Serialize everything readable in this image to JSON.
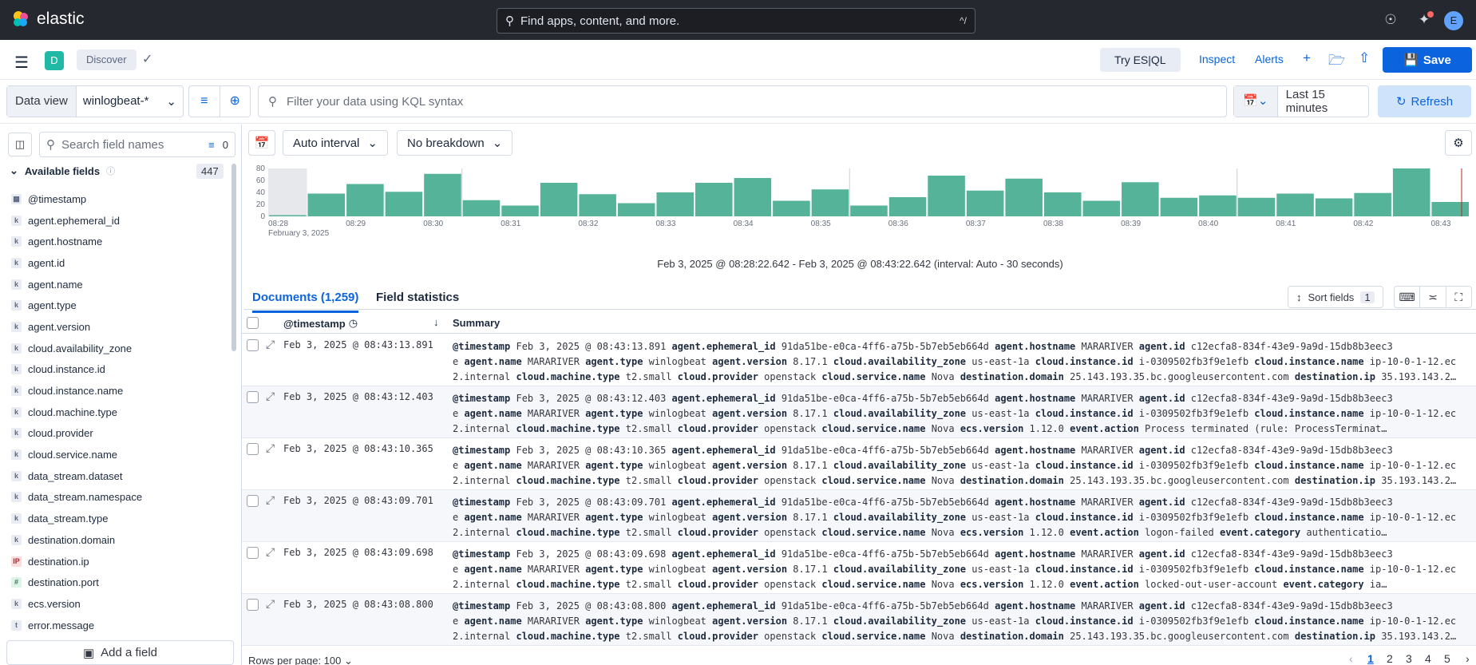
{
  "topbar": {
    "brand": "elastic",
    "search_placeholder": "Find apps, content, and more.",
    "shortcut": "^/",
    "avatar_letter": "E"
  },
  "appbar": {
    "space_letter": "D",
    "breadcrumb": "Discover",
    "try_esql": "Try ES|QL",
    "inspect": "Inspect",
    "alerts": "Alerts",
    "save": "Save"
  },
  "querybar": {
    "data_view_label": "Data view",
    "data_view_value": "winlogbeat-*",
    "kql_placeholder": "Filter your data using KQL syntax",
    "time_range": "Last 15 minutes",
    "refresh": "Refresh"
  },
  "sidebar": {
    "search_placeholder": "Search field names",
    "filter_count": "0",
    "available_label": "Available fields",
    "available_count": "447",
    "add_field": "Add a field",
    "fields": [
      {
        "type": "date",
        "name": "@timestamp"
      },
      {
        "type": "k",
        "name": "agent.ephemeral_id"
      },
      {
        "type": "k",
        "name": "agent.hostname"
      },
      {
        "type": "k",
        "name": "agent.id"
      },
      {
        "type": "k",
        "name": "agent.name"
      },
      {
        "type": "k",
        "name": "agent.type"
      },
      {
        "type": "k",
        "name": "agent.version"
      },
      {
        "type": "k",
        "name": "cloud.availability_zone"
      },
      {
        "type": "k",
        "name": "cloud.instance.id"
      },
      {
        "type": "k",
        "name": "cloud.instance.name"
      },
      {
        "type": "k",
        "name": "cloud.machine.type"
      },
      {
        "type": "k",
        "name": "cloud.provider"
      },
      {
        "type": "k",
        "name": "cloud.service.name"
      },
      {
        "type": "k",
        "name": "data_stream.dataset"
      },
      {
        "type": "k",
        "name": "data_stream.namespace"
      },
      {
        "type": "k",
        "name": "data_stream.type"
      },
      {
        "type": "k",
        "name": "destination.domain"
      },
      {
        "type": "ip",
        "name": "destination.ip"
      },
      {
        "type": "num",
        "name": "destination.port"
      },
      {
        "type": "k",
        "name": "ecs.version"
      },
      {
        "type": "t",
        "name": "error.message"
      }
    ]
  },
  "histogram": {
    "interval": "Auto interval",
    "breakdown": "No breakdown",
    "caption": "Feb 3, 2025 @ 08:28:22.642 - Feb 3, 2025 @ 08:43:22.642 (interval: Auto - 30 seconds)",
    "date_sub": "February 3, 2025",
    "bar_color": "#54b399"
  },
  "chart_data": {
    "type": "bar",
    "ylim": [
      0,
      80
    ],
    "yticks": [
      "80",
      "60",
      "40",
      "20",
      "0"
    ],
    "xticks": [
      "08:28",
      "08:29",
      "08:30",
      "08:31",
      "08:32",
      "08:33",
      "08:34",
      "08:35",
      "08:36",
      "08:37",
      "08:38",
      "08:39",
      "08:40",
      "08:41",
      "08:42",
      "08:43"
    ],
    "values": [
      2,
      38,
      54,
      41,
      71,
      27,
      18,
      56,
      37,
      22,
      40,
      56,
      64,
      26,
      45,
      18,
      32,
      68,
      43,
      63,
      40,
      26,
      57,
      31,
      35,
      31,
      38,
      30,
      39,
      80,
      24
    ]
  },
  "documents": {
    "tab_docs": "Documents (1,259)",
    "tab_stats": "Field statistics",
    "sort_fields": "Sort fields",
    "sort_count": "1",
    "col_timestamp": "@timestamp",
    "col_summary": "Summary",
    "rows": [
      {
        "ts": "Feb 3, 2025 @ 08:43:13.891",
        "l1": "<b>@timestamp</b> Feb 3, 2025 @ 08:43:13.891 <b>agent.ephemeral_id</b> 91da51be-e0ca-4ff6-a75b-5b7eb5eb664d <b>agent.hostname</b> MARARIVER <b>agent.id</b> c12ecfa8-834f-43e9-9a9d-15db8b3eec3",
        "l2": "e <b>agent.name</b> MARARIVER <b>agent.type</b> winlogbeat <b>agent.version</b> 8.17.1 <b>cloud.availability_zone</b> us-east-1a <b>cloud.instance.id</b> i-0309502fb3f9e1efb <b>cloud.instance.name</b> ip-10-0-1-12.ec",
        "l3": "2.internal <b>cloud.machine.type</b> t2.small <b>cloud.provider</b> openstack <b>cloud.service.name</b> Nova <b>destination.domain</b> 25.143.193.35.bc.googleusercontent.com <b>destination.ip</b> 35.193.143.2…"
      },
      {
        "ts": "Feb 3, 2025 @ 08:43:12.403",
        "l1": "<b>@timestamp</b> Feb 3, 2025 @ 08:43:12.403 <b>agent.ephemeral_id</b> 91da51be-e0ca-4ff6-a75b-5b7eb5eb664d <b>agent.hostname</b> MARARIVER <b>agent.id</b> c12ecfa8-834f-43e9-9a9d-15db8b3eec3",
        "l2": "e <b>agent.name</b> MARARIVER <b>agent.type</b> winlogbeat <b>agent.version</b> 8.17.1 <b>cloud.availability_zone</b> us-east-1a <b>cloud.instance.id</b> i-0309502fb3f9e1efb <b>cloud.instance.name</b> ip-10-0-1-12.ec",
        "l3": "2.internal <b>cloud.machine.type</b> t2.small <b>cloud.provider</b> openstack <b>cloud.service.name</b> Nova <b>ecs.version</b> 1.12.0 <b>event.action</b> Process terminated (rule: ProcessTerminat…"
      },
      {
        "ts": "Feb 3, 2025 @ 08:43:10.365",
        "l1": "<b>@timestamp</b> Feb 3, 2025 @ 08:43:10.365 <b>agent.ephemeral_id</b> 91da51be-e0ca-4ff6-a75b-5b7eb5eb664d <b>agent.hostname</b> MARARIVER <b>agent.id</b> c12ecfa8-834f-43e9-9a9d-15db8b3eec3",
        "l2": "e <b>agent.name</b> MARARIVER <b>agent.type</b> winlogbeat <b>agent.version</b> 8.17.1 <b>cloud.availability_zone</b> us-east-1a <b>cloud.instance.id</b> i-0309502fb3f9e1efb <b>cloud.instance.name</b> ip-10-0-1-12.ec",
        "l3": "2.internal <b>cloud.machine.type</b> t2.small <b>cloud.provider</b> openstack <b>cloud.service.name</b> Nova <b>destination.domain</b> 25.143.193.35.bc.googleusercontent.com <b>destination.ip</b> 35.193.143.2…"
      },
      {
        "ts": "Feb 3, 2025 @ 08:43:09.701",
        "l1": "<b>@timestamp</b> Feb 3, 2025 @ 08:43:09.701 <b>agent.ephemeral_id</b> 91da51be-e0ca-4ff6-a75b-5b7eb5eb664d <b>agent.hostname</b> MARARIVER <b>agent.id</b> c12ecfa8-834f-43e9-9a9d-15db8b3eec3",
        "l2": "e <b>agent.name</b> MARARIVER <b>agent.type</b> winlogbeat <b>agent.version</b> 8.17.1 <b>cloud.availability_zone</b> us-east-1a <b>cloud.instance.id</b> i-0309502fb3f9e1efb <b>cloud.instance.name</b> ip-10-0-1-12.ec",
        "l3": "2.internal <b>cloud.machine.type</b> t2.small <b>cloud.provider</b> openstack <b>cloud.service.name</b> Nova <b>ecs.version</b> 1.12.0 <b>event.action</b> logon-failed <b>event.category</b> authenticatio…"
      },
      {
        "ts": "Feb 3, 2025 @ 08:43:09.698",
        "l1": "<b>@timestamp</b> Feb 3, 2025 @ 08:43:09.698 <b>agent.ephemeral_id</b> 91da51be-e0ca-4ff6-a75b-5b7eb5eb664d <b>agent.hostname</b> MARARIVER <b>agent.id</b> c12ecfa8-834f-43e9-9a9d-15db8b3eec3",
        "l2": "e <b>agent.name</b> MARARIVER <b>agent.type</b> winlogbeat <b>agent.version</b> 8.17.1 <b>cloud.availability_zone</b> us-east-1a <b>cloud.instance.id</b> i-0309502fb3f9e1efb <b>cloud.instance.name</b> ip-10-0-1-12.ec",
        "l3": "2.internal <b>cloud.machine.type</b> t2.small <b>cloud.provider</b> openstack <b>cloud.service.name</b> Nova <b>ecs.version</b> 1.12.0 <b>event.action</b> locked-out-user-account <b>event.category</b> ia…"
      },
      {
        "ts": "Feb 3, 2025 @ 08:43:08.800",
        "l1": "<b>@timestamp</b> Feb 3, 2025 @ 08:43:08.800 <b>agent.ephemeral_id</b> 91da51be-e0ca-4ff6-a75b-5b7eb5eb664d <b>agent.hostname</b> MARARIVER <b>agent.id</b> c12ecfa8-834f-43e9-9a9d-15db8b3eec3",
        "l2": "e <b>agent.name</b> MARARIVER <b>agent.type</b> winlogbeat <b>agent.version</b> 8.17.1 <b>cloud.availability_zone</b> us-east-1a <b>cloud.instance.id</b> i-0309502fb3f9e1efb <b>cloud.instance.name</b> ip-10-0-1-12.ec",
        "l3": "2.internal <b>cloud.machine.type</b> t2.small <b>cloud.provider</b> openstack <b>cloud.service.name</b> Nova <b>destination.domain</b> 25.143.193.35.bc.googleusercontent.com <b>destination.ip</b> 35.193.143.2…"
      }
    ],
    "rows_per_page": "Rows per page: 100",
    "pages": [
      "1",
      "2",
      "3",
      "4",
      "5"
    ]
  }
}
